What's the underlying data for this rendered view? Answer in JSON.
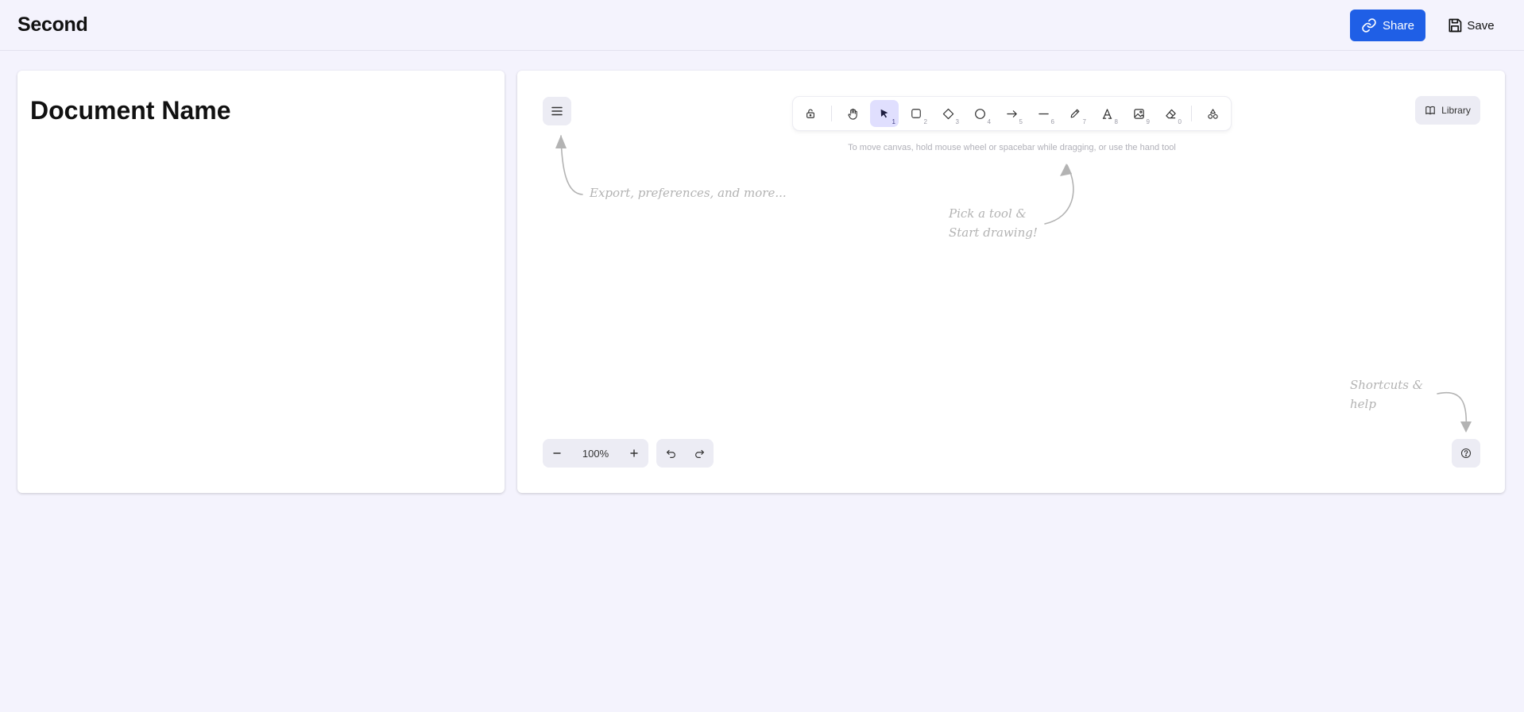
{
  "header": {
    "title": "Second",
    "share_label": "Share",
    "save_label": "Save"
  },
  "document": {
    "title": "Document Name"
  },
  "canvas": {
    "toolbar": {
      "tools": [
        {
          "name": "lock",
          "key": ""
        },
        {
          "name": "hand",
          "key": ""
        },
        {
          "name": "selection",
          "key": "1",
          "active": true
        },
        {
          "name": "rectangle",
          "key": "2"
        },
        {
          "name": "diamond",
          "key": "3"
        },
        {
          "name": "ellipse",
          "key": "4"
        },
        {
          "name": "arrow",
          "key": "5"
        },
        {
          "name": "line",
          "key": "6"
        },
        {
          "name": "draw",
          "key": "7"
        },
        {
          "name": "text",
          "key": "8"
        },
        {
          "name": "image",
          "key": "9"
        },
        {
          "name": "eraser",
          "key": "0"
        },
        {
          "name": "extra-tools",
          "key": ""
        }
      ]
    },
    "library_label": "Library",
    "hint": "To move canvas, hold mouse wheel or spacebar while dragging, or use the hand tool",
    "welcome": {
      "menu_hint": "Export, preferences, and more...",
      "tool_hint_line1": "Pick a tool &",
      "tool_hint_line2": "Start drawing!",
      "help_hint_line1": "Shortcuts &",
      "help_hint_line2": "help"
    },
    "zoom": {
      "level": "100%"
    },
    "colors": {
      "accent": "#1f5fe6",
      "active_tool_bg": "#e0dffe",
      "island_bg": "#ececf4",
      "page_bg": "#f4f3fd"
    }
  }
}
